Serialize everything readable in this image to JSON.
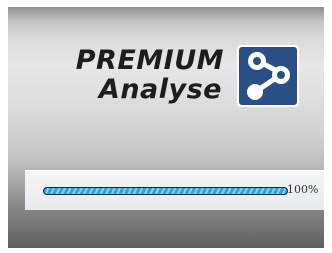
{
  "splash": {
    "brand_line1": "PREMIUM",
    "brand_line2": "Analyse",
    "logo_icon": "molecule-icon",
    "colors": {
      "logo_bg": "#2a4f86",
      "progress": "#2ba7d6",
      "text": "#1d1d1d"
    }
  },
  "progress": {
    "value": 100,
    "label": "100%"
  }
}
